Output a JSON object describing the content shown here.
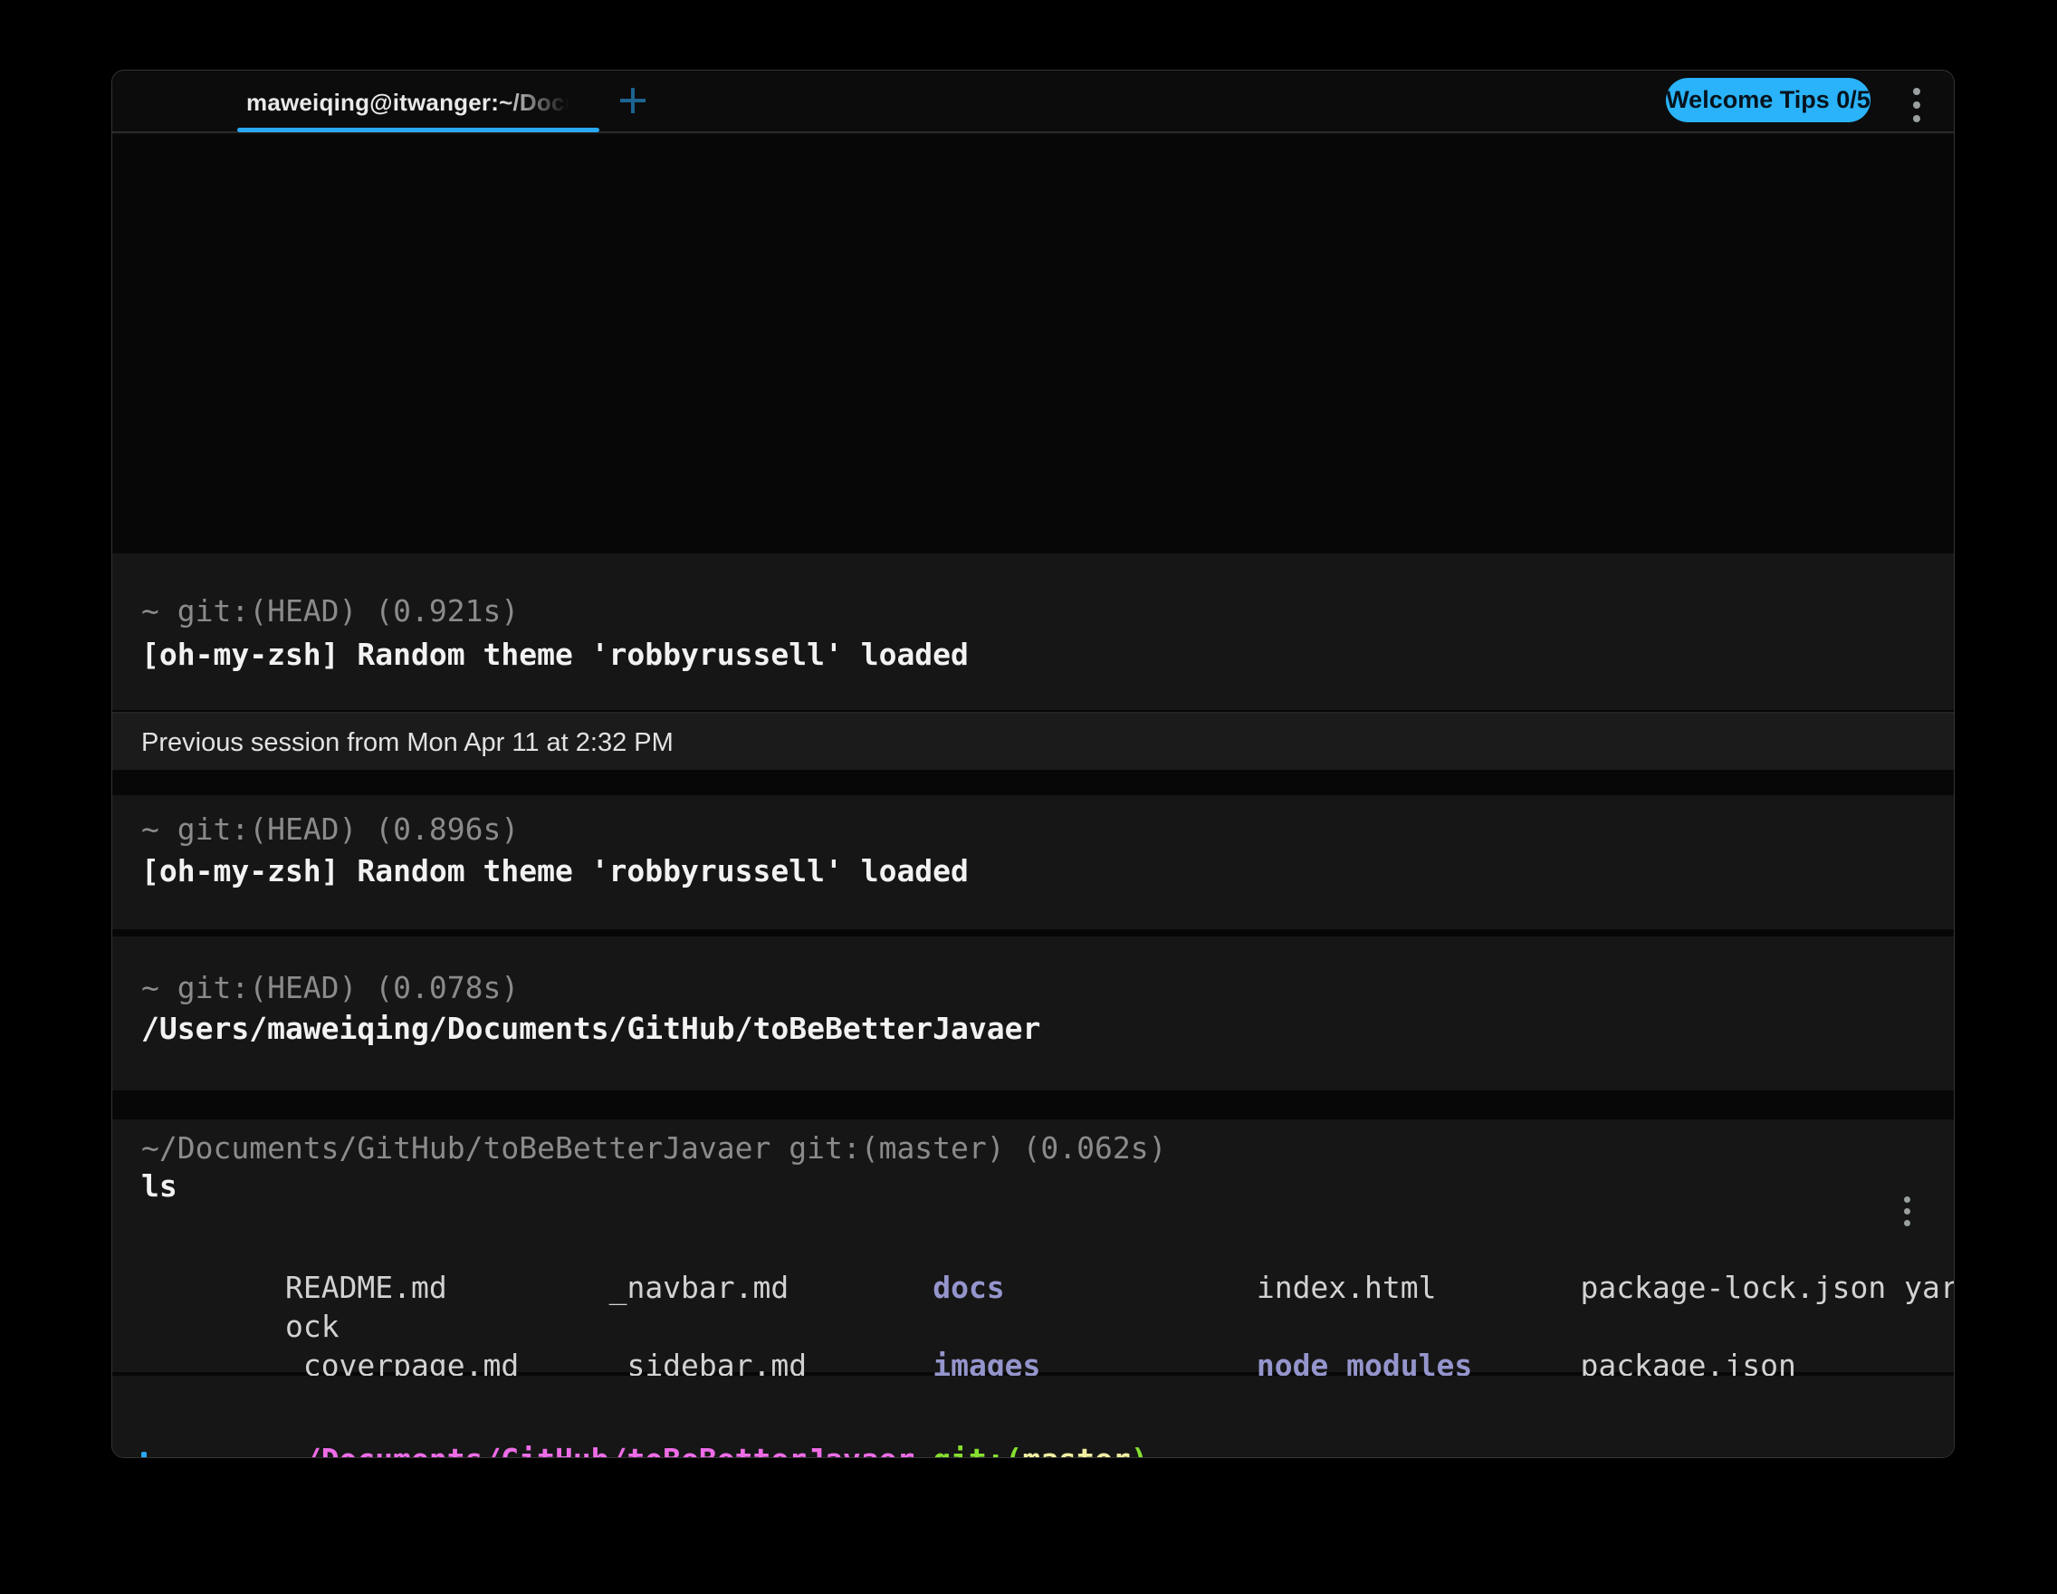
{
  "titlebar": {
    "tab_title": "maweiqing@itwanger:~/Docum",
    "welcome_tips_label": "Welcome Tips 0/5"
  },
  "colors": {
    "accent_blue": "#2ab3f9",
    "tab_underline_blue": "#29a9f7",
    "cursor_blue": "#29a8f7",
    "prompt_gray": "#8b8b8b",
    "output_white": "#f2f2f2",
    "file_gray": "#d2d2d2",
    "dir_purple": "#9595cd",
    "path_pink": "#ee6ce7",
    "git_green": "#86df2f",
    "branch_yellow": "#f0efa2",
    "traffic_red": "#ff5f57",
    "traffic_yellow": "#febc2e",
    "traffic_green": "#2bc840"
  },
  "blocks": {
    "block1": {
      "prompt": "~ git:(HEAD) (0.921s)",
      "output": "[oh-my-zsh] Random theme 'robbyrussell' loaded"
    },
    "session_banner": "Previous session from Mon Apr 11 at 2:32 PM",
    "block2": {
      "prompt": "~ git:(HEAD) (0.896s)",
      "output": "[oh-my-zsh] Random theme 'robbyrussell' loaded"
    },
    "block3": {
      "prompt": "~ git:(HEAD) (0.078s)",
      "output": "/Users/maweiqing/Documents/GitHub/toBeBetterJavaer"
    },
    "ls_block": {
      "prompt": "~/Documents/GitHub/toBeBetterJavaer git:(master) (0.062s)",
      "command": "ls",
      "rows": [
        {
          "segments": [
            {
              "text": "README.md         ",
              "kind": "file"
            },
            {
              "text": "_navbar.md        ",
              "kind": "file"
            },
            {
              "text": "docs              ",
              "kind": "dir"
            },
            {
              "text": "index.html        ",
              "kind": "file"
            },
            {
              "text": "package-lock.json ",
              "kind": "file"
            },
            {
              "text": "yarn.l",
              "kind": "file"
            }
          ]
        },
        {
          "segments": [
            {
              "text": "ock",
              "kind": "file"
            }
          ]
        },
        {
          "segments": [
            {
              "text": "_coverpage.md     ",
              "kind": "file"
            },
            {
              "text": "_sidebar.md       ",
              "kind": "file"
            },
            {
              "text": "images            ",
              "kind": "dir"
            },
            {
              "text": "node_modules      ",
              "kind": "dir"
            },
            {
              "text": "package.json",
              "kind": "file"
            }
          ]
        }
      ]
    },
    "active_prompt": {
      "segments": [
        {
          "text": "~/Documents/GitHub/toBeBetterJavaer",
          "kind": "path"
        },
        {
          "text": " ",
          "kind": "plain"
        },
        {
          "text": "git:(",
          "kind": "git"
        },
        {
          "text": "master",
          "kind": "branch"
        },
        {
          "text": ")",
          "kind": "git"
        }
      ]
    }
  }
}
